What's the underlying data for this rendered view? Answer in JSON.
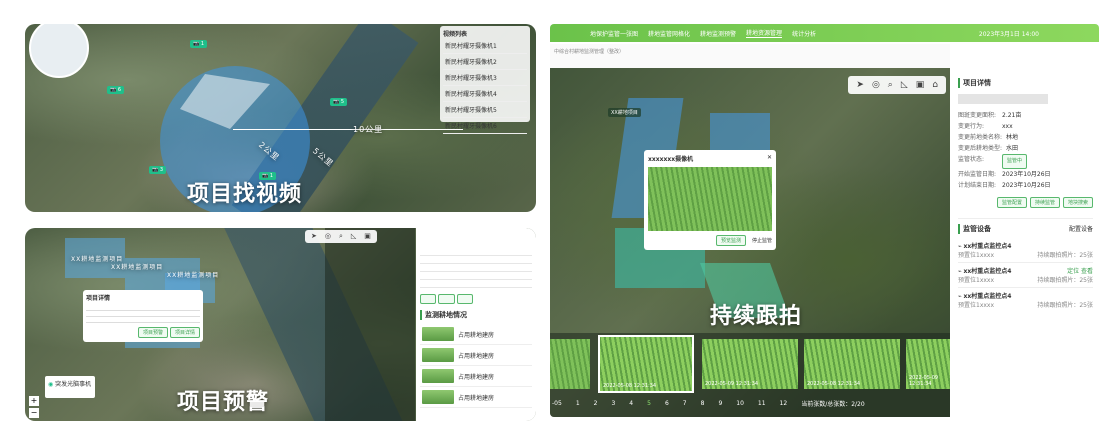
{
  "panels": {
    "p1": {
      "caption": "项目找视频",
      "distance_labels": [
        "10公里",
        "2公里",
        "5公里"
      ],
      "list_title": "视频列表",
      "list_items": [
        "新民村耀牙摄像机1",
        "新民村耀牙摄像机2",
        "新民村耀牙摄像机3",
        "新民村耀牙摄像机4",
        "新民村耀牙摄像机5",
        "新民村耀牙摄像机6"
      ]
    },
    "p2": {
      "caption": "项目预警",
      "popup_title": "项目详情",
      "popup_btn1": "项目预警",
      "popup_btn2": "项目详情",
      "zone_labels": [
        "XX耕地监测项目",
        "XX耕地监测项目",
        "XX耕地监测项目"
      ],
      "section_title": "监测耕地情况",
      "items": [
        "占用耕地建房",
        "占用耕地建房",
        "占用耕地建房",
        "占用耕地建房"
      ],
      "legend_label": "突发光脑事机"
    },
    "p3": {
      "nav": [
        "地保护监管一张图",
        "耕地监管网格化",
        "耕地监测预警",
        "耕地资源管理",
        "统计分析"
      ],
      "date": "2023年3月1日 14:00",
      "breadcrumb": "中综合村耕地监测管理（整改）",
      "caption": "持续跟拍",
      "popup_title": "xxxxxxx摄像机",
      "popup_btn1": "预览监测",
      "popup_btn2": "停止监管",
      "map_label": "XX耕地项目",
      "detail": {
        "title": "项目详情",
        "fields": [
          {
            "k": "图斑变更面积:",
            "v": "2.21亩"
          },
          {
            "k": "变更行为:",
            "v": "xxx"
          },
          {
            "k": "变更前地类名称:",
            "v": "林地"
          },
          {
            "k": "变更后耕地类型:",
            "v": "水田"
          },
          {
            "k": "监管状态:",
            "v": "监管中"
          },
          {
            "k": "开始监管日期:",
            "v": "2023年10月26日"
          },
          {
            "k": "计划结束日期:",
            "v": "2023年10月26日"
          }
        ],
        "buttons": [
          "监管配置",
          "持续监管",
          "地块搜索"
        ]
      },
      "devices": {
        "title": "监管设备",
        "config": "配置设备",
        "items": [
          {
            "name": "xx村重点监控点4",
            "sub": "预置位1xxxx",
            "count": "持续跟拍照片：25张",
            "actions": ""
          },
          {
            "name": "xx村重点监控点4",
            "sub": "预置位1xxxx",
            "count": "持续跟拍照片：25张",
            "actions": "定位  查看"
          },
          {
            "name": "xx村重点监控点4",
            "sub": "预置位1xxxx",
            "count": "持续跟拍照片：25张",
            "actions": ""
          }
        ]
      },
      "film": [
        "2022-05-08 12:31:34",
        "2022-05-09 12:31:34",
        "2022-05-08 12:31:34",
        "2022-05-09 12:31:34"
      ],
      "timeline": [
        "1",
        "2",
        "3",
        "4",
        "5",
        "6",
        "7",
        "8",
        "9",
        "10",
        "11",
        "12"
      ],
      "timeline_prefix": "-05",
      "count_text": "当前张数/总张数：2/20"
    }
  }
}
